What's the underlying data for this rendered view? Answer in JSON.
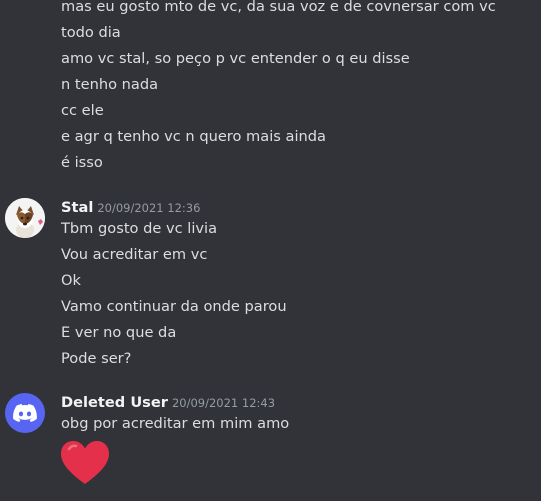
{
  "previous_message_lines": [
    "mas eu gosto mto de vc, da sua voz e de covnersar com vc",
    "todo dia",
    "amo vc stal, so peço p vc entender o q eu disse",
    "n tenho nada",
    "cc ele",
    "e agr q tenho vc n quero mais ainda",
    "é isso"
  ],
  "messages": [
    {
      "author": "Stal",
      "timestamp": "20/09/2021 12:36",
      "lines": [
        "Tbm gosto de vc livia",
        "Vou acreditar em vc",
        "Ok",
        "Vamo continuar da onde parou",
        "E ver no que da",
        "Pode ser?"
      ]
    },
    {
      "author": "Deleted User",
      "timestamp": "20/09/2021 12:43",
      "lines": [
        "obg por acreditar em mim amo"
      ],
      "emoji": "red-heart"
    }
  ],
  "colors": {
    "background": "#313338",
    "text": "#dbdee1",
    "author": "#f2f3f5",
    "timestamp": "#949ba4",
    "discord_blurple": "#5865f2",
    "heart": "#e4304a"
  }
}
